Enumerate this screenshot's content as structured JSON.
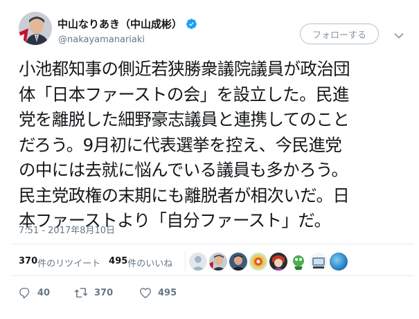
{
  "user": {
    "display_name": "中山なりあき（中山成彬）",
    "handle": "@nakayamanariaki",
    "verified": true
  },
  "header": {
    "follow_label": "フォローする"
  },
  "tweet": {
    "lines": [
      "小池都知事の側近若狭勝衆議院議員が政治団",
      "体「日本ファーストの会」を設立した。民進",
      "党を離脱した細野豪志議員と連携してのこと",
      "だろう。9月初に代表選挙を控え、今民進党",
      "の中には去就に悩んでいる議員も多かろう。",
      "民主党政権の末期にも離脱者が相次いだ。日",
      "本ファーストより「自分ファースト」だ。"
    ],
    "timestamp": "7:51 - 2017年8月10日"
  },
  "stats": {
    "retweets_count": "370",
    "retweets_label": "件のリツイート",
    "likes_count": "495",
    "likes_label": "件のいいね"
  },
  "actions": {
    "reply_count": "40",
    "retweet_count": "370",
    "like_count": "495"
  },
  "colors": {
    "accent": "#1da1f2",
    "text_secondary": "#657786",
    "divider": "#e6ecf0"
  },
  "icons": {
    "verified": "verified-badge-icon",
    "menu": "chevron-down-icon",
    "reply": "reply-icon",
    "retweet": "retweet-icon",
    "like": "heart-icon"
  }
}
